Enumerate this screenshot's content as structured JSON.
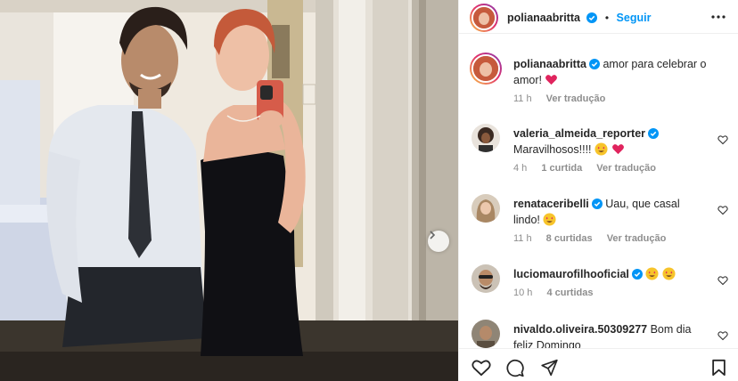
{
  "header": {
    "username": "polianaabritta",
    "separator": "•",
    "follow_label": "Seguir",
    "more_icon": "more-horizontal-icon"
  },
  "caption": {
    "username": "polianaabritta",
    "text": "amor para celebrar o amor!",
    "time": "11 h",
    "see_translation": "Ver tradução"
  },
  "comments": [
    {
      "username": "valeria_almeida_reporter",
      "verified": true,
      "text": "Maravilhosos!!!!",
      "emojis": [
        "heart-eyes",
        "red-heart"
      ],
      "time": "4 h",
      "likes": "1 curtida",
      "see_translation": "Ver tradução"
    },
    {
      "username": "renataceribelli",
      "verified": true,
      "text": "Uau, que casal lindo!",
      "emojis": [
        "heart-eyes"
      ],
      "time": "11 h",
      "likes": "8 curtidas",
      "see_translation": "Ver tradução"
    },
    {
      "username": "luciomaurofilhooficial",
      "verified": true,
      "text": "",
      "emojis": [
        "heart-eyes",
        "heart-eyes"
      ],
      "time": "10 h",
      "likes": "4 curtidas"
    },
    {
      "username": "nivaldo.oliveira.50309277",
      "verified": false,
      "text": "Bom dia feliz Domingo",
      "emojis": []
    }
  ],
  "actions": {
    "like_icon": "heart-icon",
    "comment_icon": "comment-icon",
    "share_icon": "share-icon",
    "save_icon": "bookmark-icon"
  },
  "colors": {
    "accent": "#0095f6",
    "verified": "#0095f6",
    "heart": "#ed4956",
    "muted": "#8e8e8e"
  }
}
